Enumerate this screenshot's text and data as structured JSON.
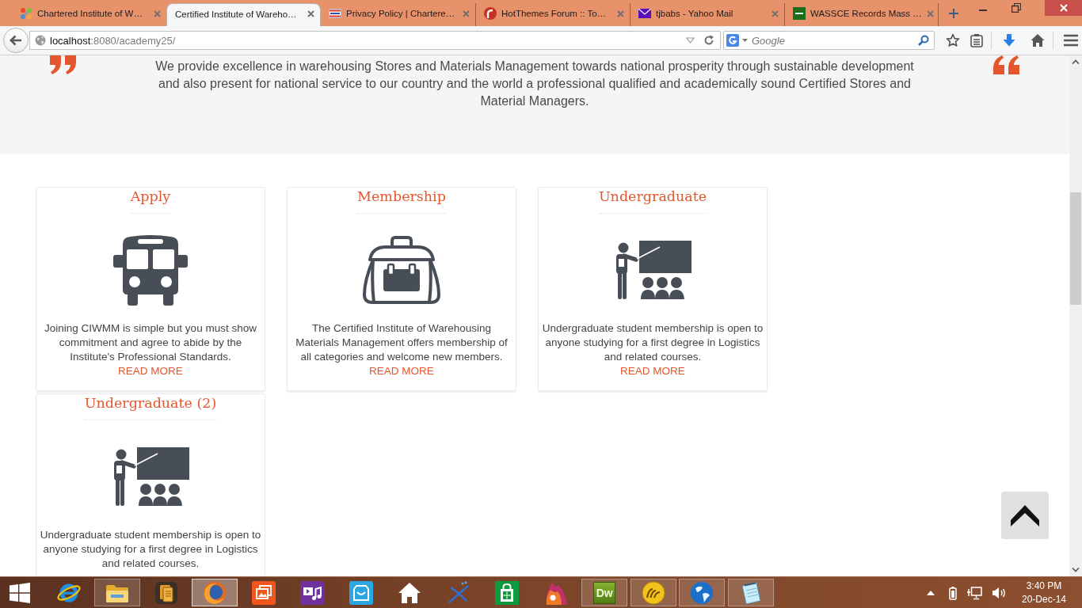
{
  "browser": {
    "tabs": [
      {
        "title": "Chartered Institute of W…",
        "kind": "pinwheel",
        "selected": false
      },
      {
        "title": "Certified Institute of Wareho…",
        "kind": "blank",
        "selected": true
      },
      {
        "title": "Privacy Policy | Chartere…",
        "kind": "banner",
        "selected": false
      },
      {
        "title": "HotThemes Forum :: To…",
        "kind": "circle",
        "selected": false
      },
      {
        "title": "tjbabs - Yahoo Mail",
        "kind": "envelope",
        "selected": false
      },
      {
        "title": "WASSCE Records Mass …",
        "kind": "square",
        "selected": false
      }
    ],
    "address": "**localhost**:8080/academy25/",
    "search": {
      "placeholder": "Google"
    }
  },
  "mission": {
    "text": "We provide excellence in warehousing Stores and Materials Management towards national prosperity through sustainable development\nand also present for national service to our country and the world a professional qualified and academically sound Certified Stores and\nMaterial Managers."
  },
  "cards": [
    {
      "title": "Apply",
      "kind": "bus",
      "text": "Joining CIWMM is simple but you must show\ncommitment and agree to abide by the\nInstitute's Professional Standards.",
      "link": "READ MORE"
    },
    {
      "title": "Membership",
      "kind": "bag",
      "text": "The Certified Institute of Warehousing\nMaterials Management offers membership of\nall categories and welcome new members.",
      "link": "READ MORE"
    },
    {
      "title": "Undergraduate",
      "kind": "teacher",
      "text": "Undergraduate student membership is open to\nanyone studying for a first degree in Logistics\nand related courses.",
      "link": "READ MORE"
    },
    {
      "title": "Undergraduate (2)",
      "kind": "teacher",
      "text": "Undergraduate student membership is open to\nanyone studying for a first degree in Logistics\nand related courses."
    }
  ],
  "taskbar": {
    "apps": [
      {
        "kind": "ring",
        "running": false,
        "selected": false
      },
      {
        "kind": "folder",
        "running": true,
        "selected": false
      },
      {
        "kind": "books",
        "running": false,
        "selected": false
      },
      {
        "kind": "fox",
        "running": true,
        "selected": true
      },
      {
        "kind": "pictures",
        "running": false,
        "selected": false
      },
      {
        "kind": "media",
        "running": false,
        "selected": false
      },
      {
        "kind": "bag",
        "running": false,
        "selected": false
      },
      {
        "kind": "house",
        "running": false,
        "selected": false
      },
      {
        "kind": "lines",
        "running": false,
        "selected": false
      },
      {
        "kind": "store",
        "running": false,
        "selected": false
      },
      {
        "kind": "flame",
        "running": false,
        "selected": false
      },
      {
        "kind": "tile",
        "label": "Dw",
        "running": true,
        "selected": false
      },
      {
        "kind": "swirl",
        "running": true,
        "selected": false
      },
      {
        "kind": "globe",
        "running": true,
        "selected": false
      },
      {
        "kind": "notepad",
        "running": true,
        "selected": false
      }
    ],
    "clock": {
      "time": "3:40 PM",
      "date": "20-Dec-14"
    }
  }
}
